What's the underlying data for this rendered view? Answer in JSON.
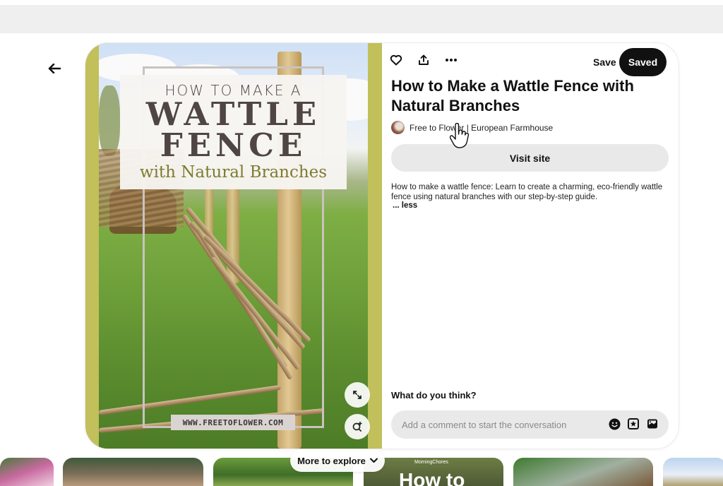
{
  "nav": {
    "back_icon": "arrow-left-icon"
  },
  "pin": {
    "image_alt": "How to make a wattle fence with natural branches",
    "image_text": {
      "line1": "HOW TO MAKE A",
      "line2": "WATTLE",
      "line3": "FENCE",
      "line4": "with Natural Branches",
      "url": "WWW.FREETOFLOWER.COM"
    },
    "image_buttons": [
      "expand-icon",
      "visual-search-icon"
    ],
    "title": "How to Make a Wattle Fence with Natural Branches",
    "source": "Free to Flower | European Farmhouse",
    "description": "How to make a wattle fence: Learn to create a charming, eco-friendly wattle fence using natural branches with our step-by-step guide.",
    "less_label": "... less"
  },
  "actions": {
    "icons": [
      "heart-icon",
      "share-icon",
      "more-icon"
    ],
    "save_label": "Save",
    "saved_label": "Saved"
  },
  "visit_label": "Visit site",
  "comments": {
    "heading": "What do you think?",
    "placeholder": "Add a comment to start the conversation",
    "icons": [
      "emoji-icon",
      "sticker-icon",
      "image-icon"
    ]
  },
  "explore": {
    "label": "More to explore",
    "thumb_text": "MorningChores",
    "thumb_big": "How to"
  },
  "colors": {
    "accent_green": "#c1c05a",
    "dark_button": "#111111",
    "light_button": "#e9e9e9"
  }
}
